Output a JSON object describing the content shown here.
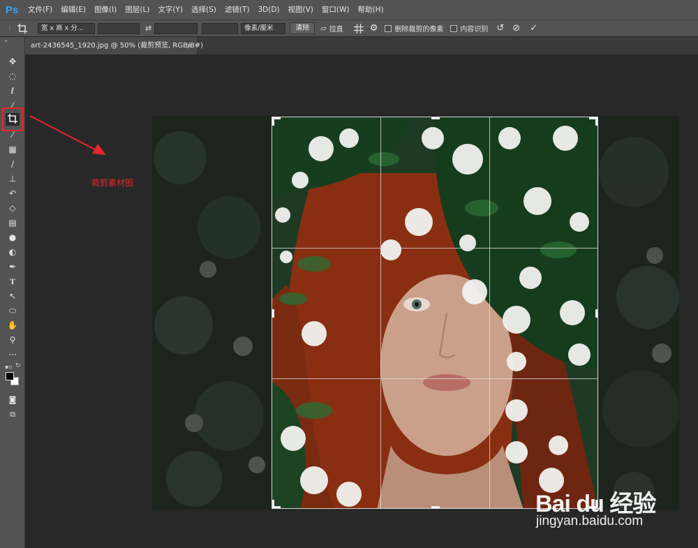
{
  "app": {
    "logo": "Ps"
  },
  "menu": [
    "文件(F)",
    "编辑(E)",
    "图像(I)",
    "图层(L)",
    "文字(Y)",
    "选择(S)",
    "滤镜(T)",
    "3D(D)",
    "视图(V)",
    "窗口(W)",
    "帮助(H)"
  ],
  "options": {
    "ratio": "宽 x 高 x 分...",
    "width_value": "",
    "height_value": "",
    "resolution_value": "",
    "unit": "像素/厘米",
    "clear": "清除",
    "straighten": "拉直",
    "delete_cropped": "删除裁剪的像素",
    "content_aware": "内容识别"
  },
  "document_tab": {
    "title": "art-2436545_1920.jpg @ 50% (裁剪预览, RGB/8#)",
    "close": "×"
  },
  "annotation": {
    "label": "裁剪素材图",
    "color": "#e6272a"
  },
  "watermark": {
    "brand": "Bai du 经验",
    "url": "jingyan.baidu.com"
  },
  "colors": {
    "accent": "#31a8ff",
    "highlight": "#e6272a",
    "panel": "#535353",
    "workspace": "#282828"
  },
  "icons": {
    "tools": [
      "move-icon",
      "marquee-icon",
      "lasso-icon",
      "quick-select-icon",
      "crop-icon",
      "eyedropper-icon",
      "healing-icon",
      "brush-icon",
      "stamp-icon",
      "history-brush-icon",
      "eraser-icon",
      "gradient-icon",
      "blur-icon",
      "dodge-icon",
      "pen-icon",
      "type-icon",
      "path-select-icon",
      "shape-icon",
      "hand-icon",
      "zoom-icon",
      "more-icon"
    ]
  }
}
